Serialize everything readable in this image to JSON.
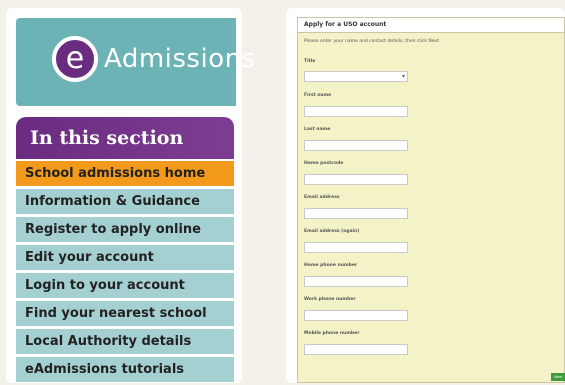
{
  "brand": {
    "logo_letter": "e",
    "name": "Admissions"
  },
  "section": {
    "heading": "In this section",
    "items": [
      {
        "label": "School admissions home",
        "active": true
      },
      {
        "label": "Information & Guidance",
        "active": false
      },
      {
        "label": "Register to apply online",
        "active": false
      },
      {
        "label": "Edit your account",
        "active": false
      },
      {
        "label": "Login to your account",
        "active": false
      },
      {
        "label": "Find your nearest school",
        "active": false
      },
      {
        "label": "Local Authority details",
        "active": false
      },
      {
        "label": "eAdmissions tutorials",
        "active": false
      }
    ]
  },
  "form": {
    "title": "Apply for a USO account",
    "intro": "Please enter your name and contact details, then click Next.",
    "fields": {
      "title": "Title",
      "first_name": "First name",
      "last_name": "Last name",
      "home_postcode": "Home postcode",
      "email": "Email address",
      "email_again": "Email address (again)",
      "home_phone": "Home phone number",
      "work_phone": "Work phone number",
      "mobile_phone": "Mobile phone number"
    },
    "submit_label": "Next"
  },
  "colors": {
    "brand_teal": "#6bb3b5",
    "section_purple": "#6b2b80",
    "nav_item": "#a5d0d2",
    "nav_active": "#f39a1c",
    "form_background": "#f4f3c8"
  }
}
